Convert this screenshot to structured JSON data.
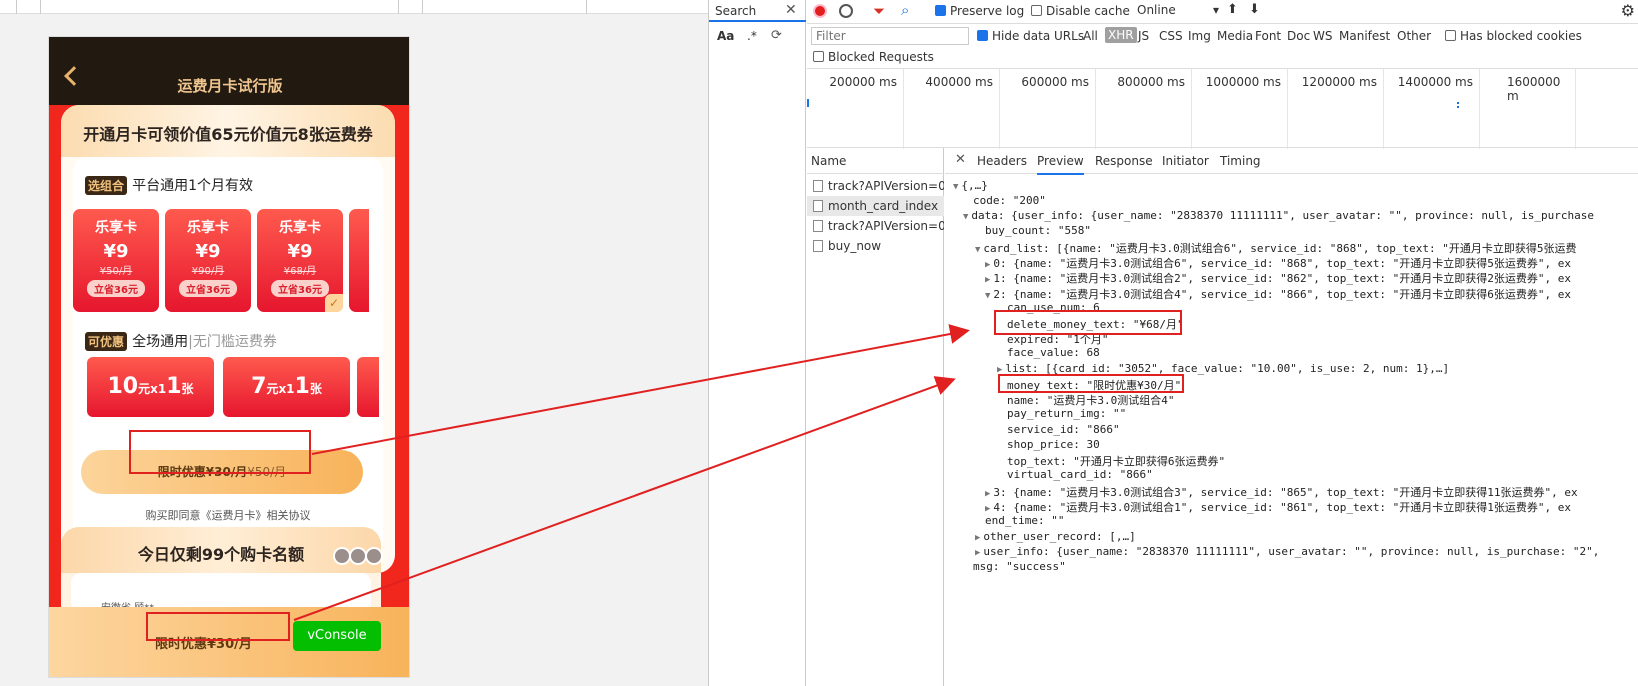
{
  "phone": {
    "title": "运费月卡试行版",
    "headline": "开通月卡可领价值65元价值元8张运费券",
    "section1": {
      "tag": "选组合",
      "title": "平台通用1个月有效"
    },
    "cards": [
      {
        "name": "乐享卡",
        "price": "¥9",
        "orig": "¥50/月",
        "save": "立省36元"
      },
      {
        "name": "乐享卡",
        "price": "¥9",
        "orig": "¥90/月",
        "save": "立省36元"
      },
      {
        "name": "乐享卡",
        "price": "¥9",
        "orig": "¥68/月",
        "save": "立省36元"
      }
    ],
    "section2": {
      "tag": "可优惠",
      "title": "全场通用",
      "sub": "|无门槛运费券"
    },
    "coupons": [
      {
        "amount": "10",
        "unit": "元x1",
        "count": "张"
      },
      {
        "amount": "7",
        "unit": "元x1",
        "count": "张"
      }
    ],
    "buy_bar": {
      "label": "限时优惠¥30/月",
      "strike": "¥50/月"
    },
    "agree_text": "购买即同意《运费月卡》相关协议",
    "quota_title": "今日仅剩99个购卡名额",
    "record_text": "安徽省 顾**",
    "bottom_buy": "限时优惠¥30/月",
    "vconsole": "vConsole"
  },
  "devtools": {
    "search_tab": "Search",
    "search_aa": "Aa",
    "search_regex": ".*",
    "preserve_log": "Preserve log",
    "disable_cache": "Disable cache",
    "throttle": "Online",
    "filter_placeholder": "Filter",
    "hide_data_urls": "Hide data URLs",
    "types": [
      "All",
      "XHR",
      "JS",
      "CSS",
      "Img",
      "Media",
      "Font",
      "Doc",
      "WS",
      "Manifest",
      "Other"
    ],
    "has_blocked_cookies": "Has blocked cookies",
    "blocked_requests": "Blocked Requests",
    "timeline_ticks": [
      "200000 ms",
      "400000 ms",
      "600000 ms",
      "800000 ms",
      "1000000 ms",
      "1200000 ms",
      "1400000 ms",
      "1600000 m"
    ],
    "name_header": "Name",
    "requests": [
      "track?APIVersion=0....",
      "month_card_index",
      "track?APIVersion=0....",
      "buy_now"
    ],
    "detail_tabs": [
      "Headers",
      "Preview",
      "Response",
      "Initiator",
      "Timing"
    ],
    "json_lines": [
      "{,…}",
      "code: \"200\"",
      "data: {user_info: {user_name: \"2838370 11111111\", user_avatar: \"\", province: null, is_purchase",
      "buy_count: \"558\"",
      "card_list: [{name: \"运费月卡3.0测试组合6\", service_id: \"868\", top_text: \"开通月卡立即获得5张运费",
      "0: {name: \"运费月卡3.0测试组合6\", service_id: \"868\", top_text: \"开通月卡立即获得5张运费券\", ex",
      "1: {name: \"运费月卡3.0测试组合2\", service_id: \"862\", top_text: \"开通月卡立即获得2张运费券\", ex",
      "2: {name: \"运费月卡3.0测试组合4\", service_id: \"866\", top_text: \"开通月卡立即获得6张运费券\", ex",
      "can_use_num: 6",
      "delete_money_text: \"¥68/月\"",
      "expired: \"1个月\"",
      "face_value: 68",
      "list: [{card_id: \"3052\", face_value: \"10.00\", is_use: 2, num: 1},…]",
      "money_text: \"限时优惠¥30/月\"",
      "name: \"运费月卡3.0测试组合4\"",
      "pay_return_img: \"\"",
      "service_id: \"866\"",
      "shop_price: 30",
      "top_text: \"开通月卡立即获得6张运费券\"",
      "virtual_card_id: \"866\"",
      "3: {name: \"运费月卡3.0测试组合3\", service_id: \"865\", top_text: \"开通月卡立即获得11张运费券\", ex",
      "4: {name: \"运费月卡3.0测试组合1\", service_id: \"861\", top_text: \"开通月卡立即获得1张运费券\", ex",
      "end_time: \"\"",
      "other_user_record: [,…]",
      "user_info: {user_name: \"2838370 11111111\", user_avatar: \"\", province: null, is_purchase: \"2\",",
      "msg: \"success\""
    ]
  },
  "colors": {
    "accent_red": "#e12020",
    "devtools_blue": "#1a73e8",
    "vconsole_green": "#04be02"
  }
}
